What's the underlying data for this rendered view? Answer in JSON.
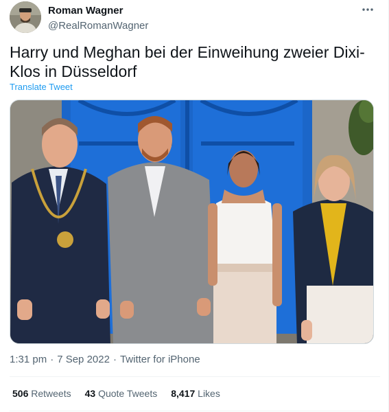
{
  "author": {
    "display_name": "Roman Wagner",
    "handle": "@RealRomanWagner"
  },
  "tweet": {
    "text": "Harry und Meghan bei der Einweihung zweier Dixi-Klos in Düsseldorf",
    "translate_label": "Translate Tweet"
  },
  "meta": {
    "time": "1:31 pm",
    "date": "7 Sep 2022",
    "source": "Twitter for iPhone",
    "separator": "·"
  },
  "stats": [
    {
      "count": "506",
      "label": "Retweets"
    },
    {
      "count": "43",
      "label": "Quote Tweets"
    },
    {
      "count": "8,417",
      "label": "Likes"
    }
  ],
  "icons": {
    "more": "more-options-icon"
  },
  "colors": {
    "link": "#1d9bf0",
    "secondary_text": "#536471",
    "primary_text": "#0f1419",
    "door_blue": "#1b66c9"
  }
}
